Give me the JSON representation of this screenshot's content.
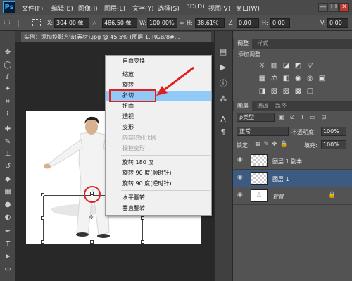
{
  "app": {
    "logo": "Ps"
  },
  "menu": {
    "items": [
      "文件(F)",
      "编辑(E)",
      "图像(I)",
      "图层(L)",
      "文字(Y)",
      "选择(S)",
      "3D(D)",
      "视图(V)",
      "窗口(W)"
    ]
  },
  "window_buttons": {
    "minimize": "—",
    "restore": "❐",
    "close": "✕"
  },
  "options": {
    "x_label": "X:",
    "x_value": "304.00 像",
    "y_value": "486.50 像",
    "w_label": "W:",
    "w_value": "100.00%",
    "h_label": "H:",
    "h_value": "38.61%",
    "angle_value": "0.00",
    "hskew_label": "H:",
    "hskew_value": "0.00",
    "vskew_label": "V:",
    "vskew_value": "0.00"
  },
  "document": {
    "tab_title": "实例：添加投影方法(素材).jpg @ 45.5% (图层 1, RGB/8#..."
  },
  "context_menu": {
    "items": [
      {
        "label": "自由变换",
        "state": "normal"
      },
      {
        "label": "缩放",
        "state": "normal"
      },
      {
        "label": "旋转",
        "state": "normal"
      },
      {
        "label": "斜切",
        "state": "highlighted"
      },
      {
        "label": "扭曲",
        "state": "normal"
      },
      {
        "label": "透视",
        "state": "normal"
      },
      {
        "label": "变形",
        "state": "normal"
      },
      {
        "label": "内容识别比例",
        "state": "disabled"
      },
      {
        "label": "操控变形",
        "state": "disabled"
      },
      {
        "label": "旋转 180 度",
        "state": "normal"
      },
      {
        "label": "旋转 90 度(顺时针)",
        "state": "normal"
      },
      {
        "label": "旋转 90 度(逆时针)",
        "state": "normal"
      },
      {
        "label": "水平翻转",
        "state": "normal"
      },
      {
        "label": "垂直翻转",
        "state": "normal"
      }
    ]
  },
  "adjustments_panel": {
    "tabs": [
      "调整",
      "样式"
    ],
    "title": "添加调整"
  },
  "layers_panel": {
    "tabs": [
      "图层",
      "通道",
      "路径"
    ],
    "filter_label": "ρ类型",
    "blend_mode": "正常",
    "opacity_label": "不透明度:",
    "opacity_value": "100%",
    "lock_label": "锁定:",
    "fill_label": "填充:",
    "fill_value": "100%",
    "layers": [
      {
        "name": "图层 1 副本",
        "selected": false
      },
      {
        "name": "图层 1",
        "selected": true
      },
      {
        "name": "背景",
        "selected": false
      }
    ]
  },
  "icons": {
    "eye": "eye-icon",
    "lock": "lock-icon",
    "arrow": "annotation-arrow"
  },
  "colors": {
    "highlight": "#91c9f7",
    "annotation": "#e02020",
    "selected_layer": "#3d5a80"
  }
}
